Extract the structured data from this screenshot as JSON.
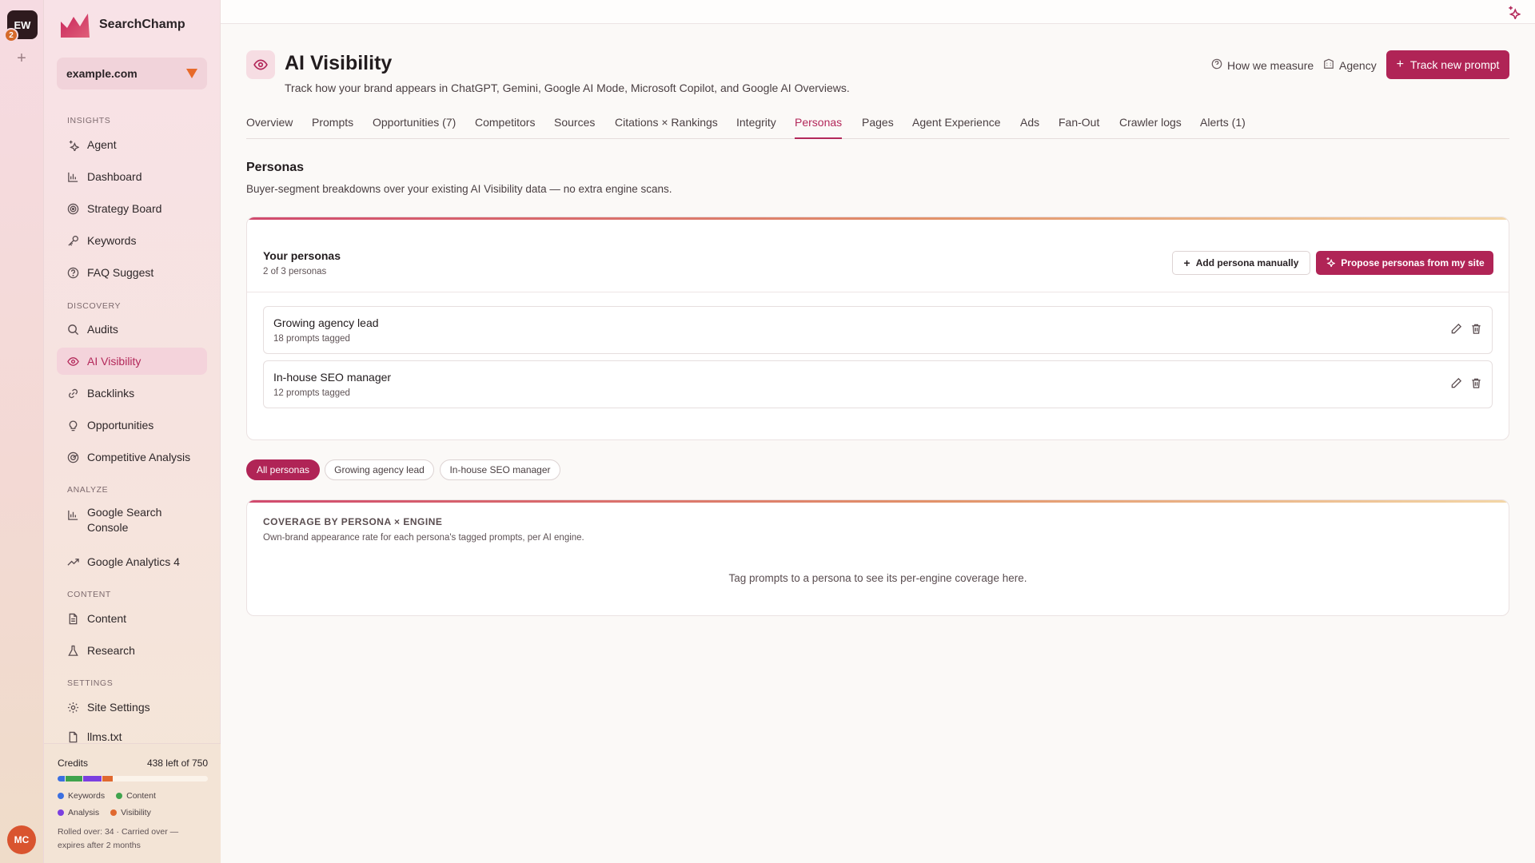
{
  "rail": {
    "workspace_initials": "EW",
    "notif_count": "2",
    "add": "+",
    "user_initials": "MC"
  },
  "brand": {
    "name": "SearchChamp"
  },
  "site": {
    "domain": "example.com"
  },
  "nav": {
    "insights": "INSIGHTS",
    "discovery": "DISCOVERY",
    "analyze": "ANALYZE",
    "content": "CONTENT",
    "settings": "SETTINGS",
    "items": {
      "agent": "Agent",
      "dashboard": "Dashboard",
      "strategy": "Strategy Board",
      "keywords": "Keywords",
      "faq": "FAQ Suggest",
      "audits": "Audits",
      "ai_visibility": "AI Visibility",
      "backlinks": "Backlinks",
      "opportunities": "Opportunities",
      "competitive": "Competitive Analysis",
      "gsc_line1": "Google Search",
      "gsc_line2": "Console",
      "ga4": "Google Analytics 4",
      "content": "Content",
      "research": "Research",
      "site_settings": "Site Settings",
      "llms": "llms.txt"
    }
  },
  "credits": {
    "label": "Credits",
    "remaining": "438 left of 750",
    "segments": [
      {
        "name": "Keywords",
        "color": "#3b6fe0",
        "fraction": 0.05
      },
      {
        "name": "Content",
        "color": "#3fa34d",
        "fraction": 0.11
      },
      {
        "name": "Analysis",
        "color": "#7b3fe0",
        "fraction": 0.12
      },
      {
        "name": "Visibility",
        "color": "#e0682f",
        "fraction": 0.07
      }
    ],
    "note": "Rolled over: 34 · Carried over — expires after 2 months"
  },
  "header": {
    "title": "AI Visibility",
    "subtitle": "Track how your brand appears in ChatGPT, Gemini, Google AI Mode, Microsoft Copilot, and Google AI Overviews.",
    "how_we_measure": "How we measure",
    "agency": "Agency",
    "track_btn": "Track new prompt"
  },
  "tabs": [
    "Overview",
    "Prompts",
    "Opportunities (7)",
    "Competitors",
    "Sources",
    "Citations × Rankings",
    "Integrity",
    "Personas",
    "Pages",
    "Agent Experience",
    "Ads",
    "Fan-Out",
    "Crawler logs",
    "Alerts (1)"
  ],
  "section": {
    "title": "Personas",
    "subtitle": "Buyer-segment breakdowns over your existing AI Visibility data — no extra engine scans."
  },
  "personas_card": {
    "title": "Your personas",
    "count": "2 of 3 personas",
    "add_btn": "Add persona manually",
    "propose_btn": "Propose personas from my site",
    "rows": [
      {
        "name": "Growing agency lead",
        "tagged": "18 prompts tagged"
      },
      {
        "name": "In-house SEO manager",
        "tagged": "12 prompts tagged"
      }
    ]
  },
  "filters": [
    "All personas",
    "Growing agency lead",
    "In-house SEO manager"
  ],
  "coverage": {
    "title": "COVERAGE BY PERSONA × ENGINE",
    "subtitle": "Own-brand appearance rate for each persona's tagged prompts, per AI engine.",
    "empty": "Tag prompts to a persona to see its per-engine coverage here."
  }
}
